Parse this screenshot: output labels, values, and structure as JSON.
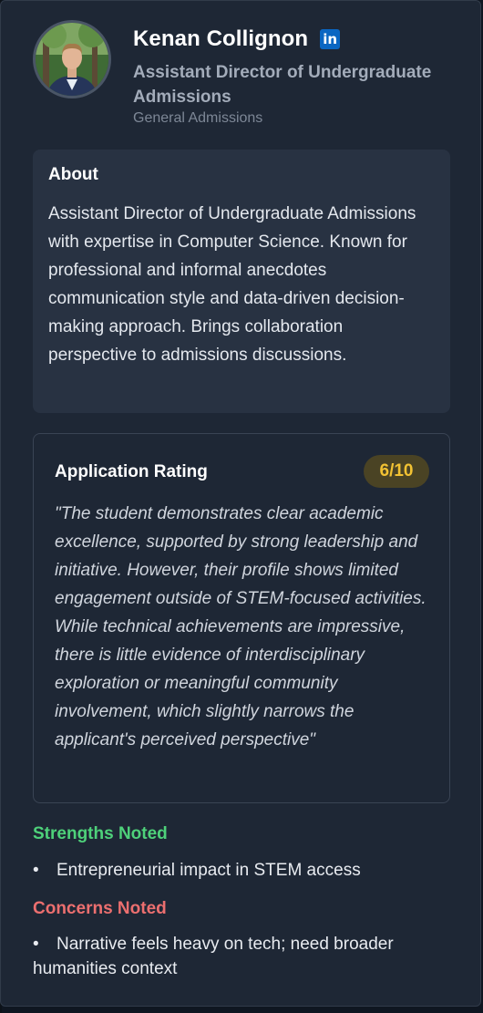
{
  "profile": {
    "name": "Kenan Collignon",
    "title": "Assistant Director of Undergraduate Admissions",
    "department": "General Admissions",
    "linkedin_icon": "linkedin-icon",
    "linkedin_label": "in"
  },
  "about": {
    "heading": "About",
    "text": "Assistant Director of Undergraduate Admissions with expertise in Computer Science. Known for professional and informal anecdotes communication style and data-driven decision-making approach. Brings collaboration perspective to admissions discussions."
  },
  "rating": {
    "heading": "Application Rating",
    "score": "6/10",
    "score_color": "#f2c233",
    "quote": "\"The student demonstrates clear academic excellence, supported by strong leadership and initiative. However, their profile shows limited engagement outside of STEM-focused activities. While technical achievements are impressive, there is little evidence of interdisciplinary exploration or meaningful community involvement, which slightly narrows the applicant's perceived perspective\""
  },
  "strengths": {
    "heading": "Strengths Noted",
    "color": "#4ed17a",
    "items": [
      "Entrepreneurial impact in STEM access"
    ]
  },
  "concerns": {
    "heading": "Concerns Noted",
    "color": "#ec6f6f",
    "items": [
      "Narrative feels heavy on tech; need broader humanities context"
    ]
  },
  "bullet": "•"
}
